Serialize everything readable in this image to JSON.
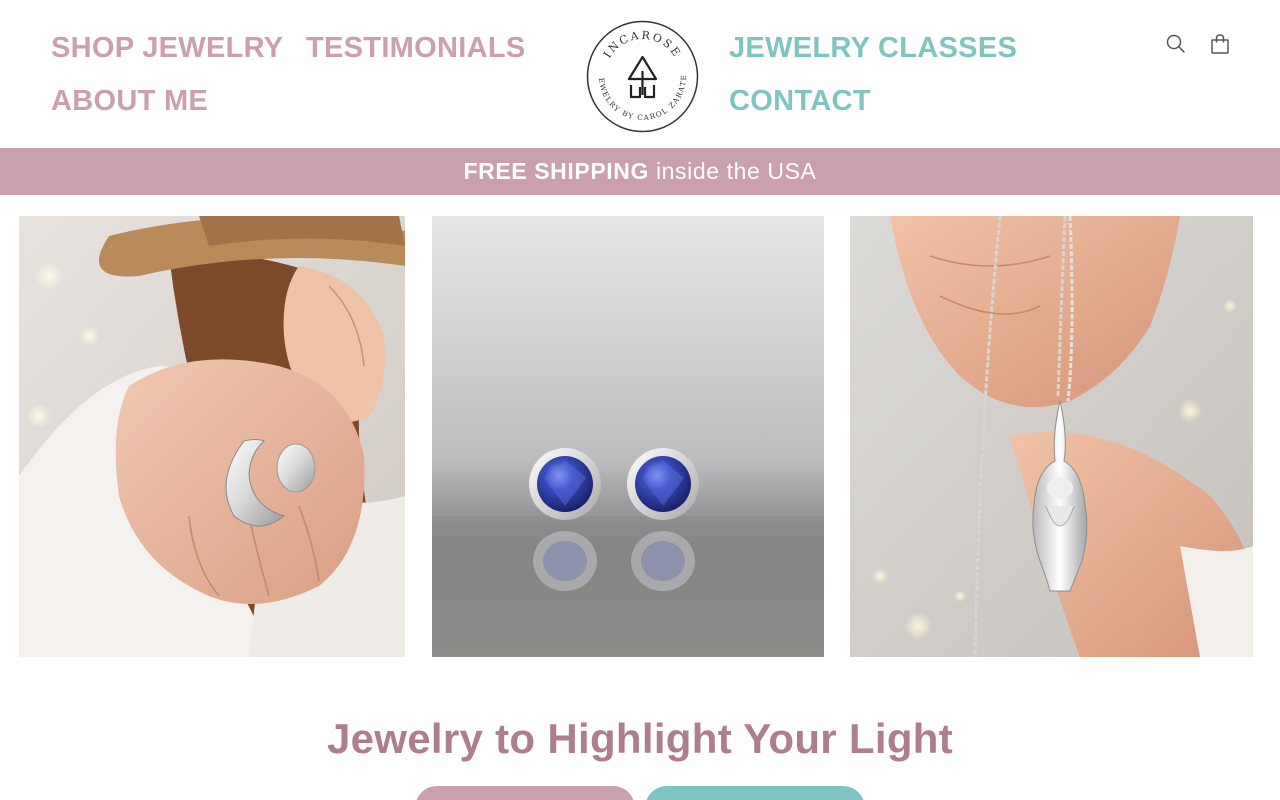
{
  "nav": {
    "left": [
      {
        "label": "SHOP JEWELRY"
      },
      {
        "label": "TESTIMONIALS"
      },
      {
        "label": "ABOUT ME"
      }
    ],
    "right": [
      {
        "label": "JEWELRY CLASSES"
      },
      {
        "label": "CONTACT"
      }
    ]
  },
  "logo": {
    "brand_arc_top": "INCAROSE",
    "brand_arc_bottom": "JEWELRY BY CAROL ZARATE",
    "icon": "incarose-monogram-logo"
  },
  "header_icons": {
    "search": "search-icon",
    "cart": "cart-icon"
  },
  "announcement": {
    "bold": "FREE SHIPPING",
    "rest": "inside the USA"
  },
  "gallery": [
    {
      "name": "photo-moon-ring",
      "subject": "woman-in-hat-wearing-silver-moon-ring"
    },
    {
      "name": "photo-sapphire-earrings",
      "subject": "blue-stone-stud-earrings"
    },
    {
      "name": "photo-gnome-necklace",
      "subject": "silver-gnome-pendant-necklace"
    }
  ],
  "hero": {
    "headline": "Jewelry to Highlight Your Light"
  },
  "cta": {
    "shop_label": "",
    "classes_label": ""
  },
  "colors": {
    "brand_pink": "#c9a0ac",
    "brand_teal": "#7fc4c0",
    "headline": "#ad7f8d",
    "announcement_text": "#ffffff"
  }
}
